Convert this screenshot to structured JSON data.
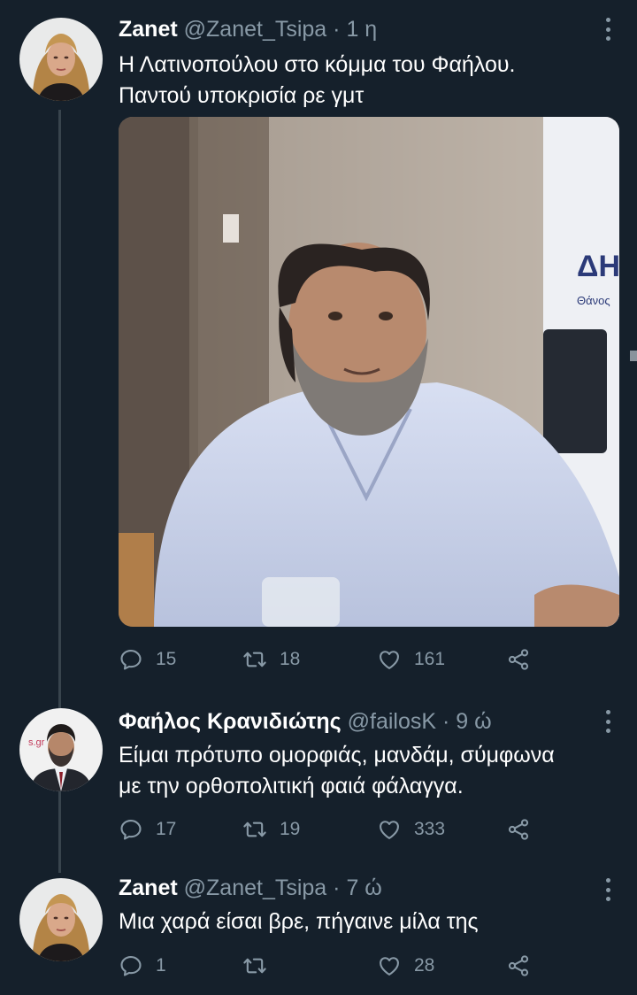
{
  "tweets": [
    {
      "name": "Zanet",
      "handle": "@Zanet_Tsipa",
      "separator": "·",
      "time": "1 η",
      "text_lines": [
        "Η Λατινοπούλου στο κόμμα του Φαήλου.",
        "Παντού υποκρισία ρε γμτ"
      ],
      "media": {
        "sign_text": "ΔΗ",
        "sign_subtext": "Θάνος"
      },
      "replies": "15",
      "retweets": "18",
      "likes": "161"
    },
    {
      "name": "Φαήλος Κρανιδιώτης",
      "handle": "@failosK",
      "separator": "·",
      "time": "9 ώ",
      "avatar_text": "s.gr",
      "text_lines": [
        "Είμαι πρότυπο ομορφιάς, μανδάμ, σύμφωνα",
        "με την ορθοπολιτική φαιά φάλαγγα."
      ],
      "replies": "17",
      "retweets": "19",
      "likes": "333"
    },
    {
      "name": "Zanet",
      "handle": "@Zanet_Tsipa",
      "separator": "·",
      "time": "7 ώ",
      "text_lines": [
        "Μια χαρά είσαι βρε, πήγαινε μίλα της"
      ],
      "replies": "1",
      "retweets": "",
      "likes": "28"
    }
  ],
  "icons": {
    "reply": "reply-icon",
    "retweet": "retweet-icon",
    "like": "heart-icon",
    "share": "share-icon",
    "more": "more-options-icon"
  },
  "colors": {
    "background": "#15202b",
    "text_primary": "#ffffff",
    "text_secondary": "#8899a6",
    "thread_line": "#38444d"
  }
}
